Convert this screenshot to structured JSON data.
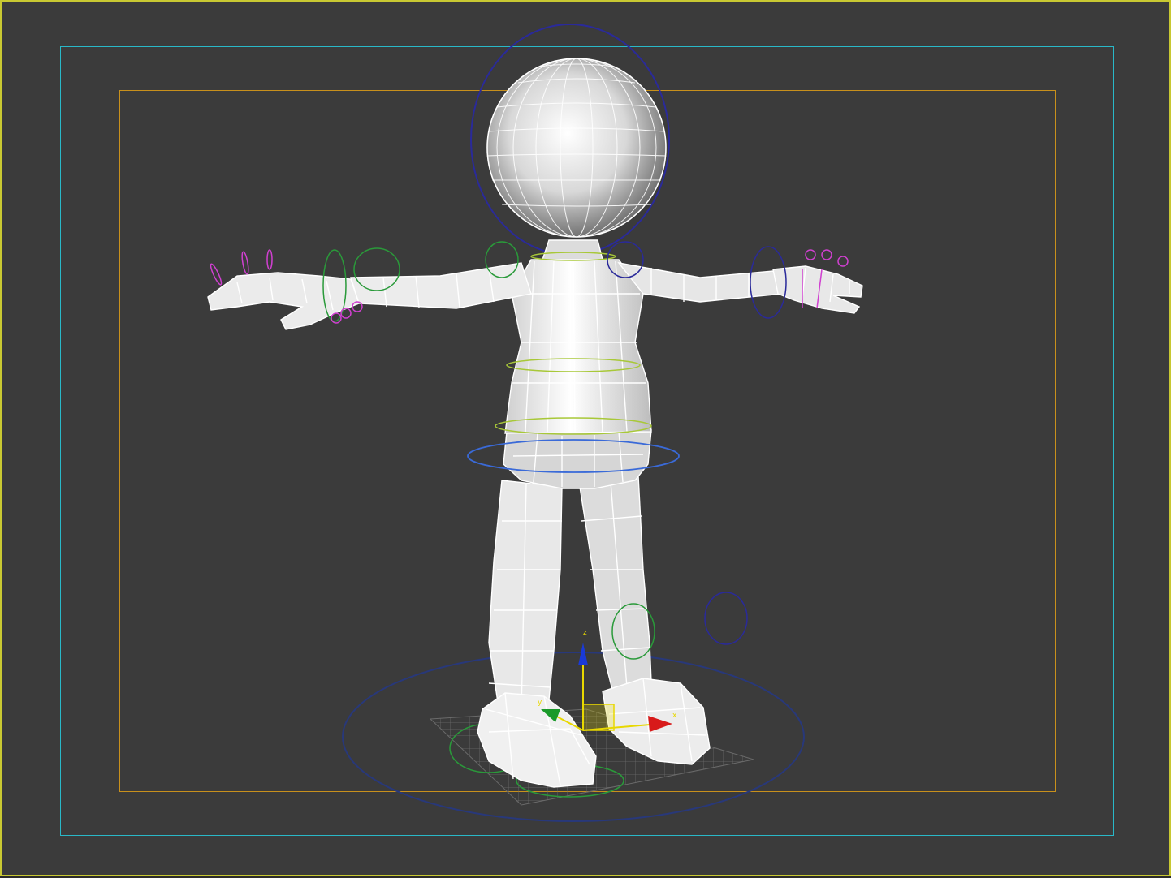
{
  "viewport": {
    "background": "#3b3b3b",
    "active_border_color": "#c8c832",
    "action_safe_color": "#29b8c8",
    "title_safe_color": "#c8901c"
  },
  "gizmo": {
    "z_label": "z",
    "y_label": "y",
    "x_label": "x",
    "z_color": "#1a3ad8",
    "y_color": "#1a9a2a",
    "x_color": "#d81a1a",
    "plane_color": "#e8d800"
  },
  "rig_controls": {
    "body_color": "#3a6ad8",
    "spine_color": "#a8c838",
    "limb_color": "#2a9a3a",
    "head_color": "#2a2a9a",
    "finger_color": "#d040d0",
    "ground_color": "#28387a"
  },
  "mesh": {
    "fill": "#f2f2f2",
    "wire": "#ffffff",
    "shade": "#c8c8c8"
  }
}
